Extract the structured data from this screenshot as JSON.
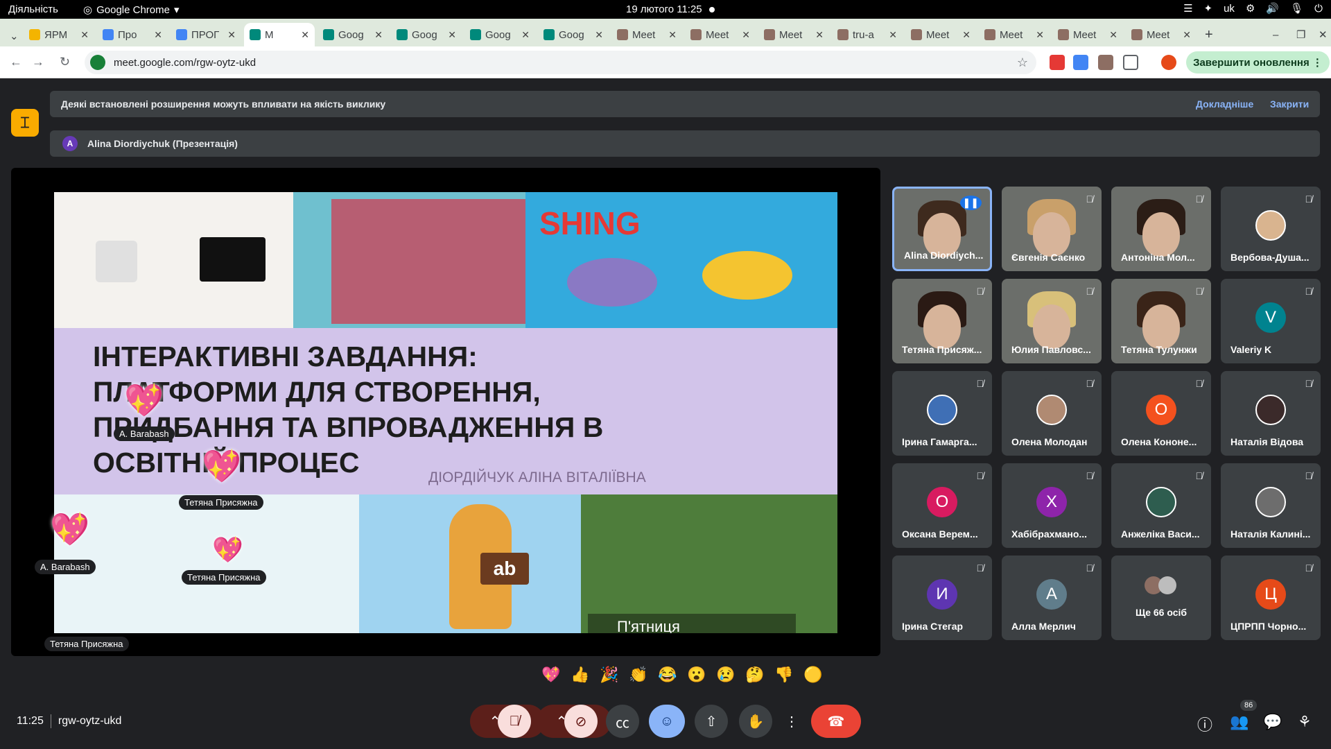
{
  "os": {
    "activities": "Діяльність",
    "app": "Google Chrome",
    "datetime": "19 лютого  11:25",
    "lang": "uk"
  },
  "tabs": [
    {
      "label": "ЯРМ",
      "color": "#f4b400"
    },
    {
      "label": "Про",
      "color": "#4285f4"
    },
    {
      "label": "ПРОГ",
      "color": "#4285f4"
    },
    {
      "label": "М",
      "color": "#00897b",
      "active": true
    },
    {
      "label": "Goog",
      "color": "#00897b"
    },
    {
      "label": "Goog",
      "color": "#00897b"
    },
    {
      "label": "Goog",
      "color": "#00897b"
    },
    {
      "label": "Goog",
      "color": "#00897b"
    },
    {
      "label": "Meet",
      "color": "#8d6e63"
    },
    {
      "label": "Meet",
      "color": "#8d6e63"
    },
    {
      "label": "Meet",
      "color": "#8d6e63"
    },
    {
      "label": "tru-a",
      "color": "#8d6e63"
    },
    {
      "label": "Meet",
      "color": "#8d6e63"
    },
    {
      "label": "Meet",
      "color": "#8d6e63"
    },
    {
      "label": "Meet",
      "color": "#8d6e63"
    },
    {
      "label": "Meet",
      "color": "#8d6e63"
    }
  ],
  "address": {
    "url": "meet.google.com/rgw-oytz-ukd",
    "update_button": "Завершити оновлення"
  },
  "notice": {
    "text": "Деякі встановлені розширення можуть впливати на якість виклику",
    "more": "Докладніше",
    "close": "Закрити"
  },
  "presenter": {
    "initial": "A",
    "label": "Alina Diordiychuk (Презентація)"
  },
  "slide": {
    "title_lines": [
      "ІНТЕРАКТИВНІ ЗАВДАННЯ:",
      "ПЛАТФОРМИ ДЛЯ СТВОРЕННЯ,",
      "ПРИДБАННЯ ТА ВПРОВАДЖЕННЯ В",
      "ОСВІТНІЙ ПРОЦЕС"
    ],
    "author": "ДІОРДІЙЧУК АЛІНА ВІТАЛІЇВНА",
    "top_word": "SHING",
    "tag": "ab",
    "friday": "П'ятниця"
  },
  "reaction_labels": [
    "A. Barabash",
    "Тетяна Присяжна",
    "A. Barabash",
    "Тетяна Присяжна",
    "Тетяна Присяжна"
  ],
  "participants": [
    {
      "name": "Alina Diordiych...",
      "type": "photo",
      "hair": "#3e2a1e",
      "active": true
    },
    {
      "name": "Євгенія Саєнко",
      "type": "photo",
      "hair": "#c9a06a"
    },
    {
      "name": "Антоніна Мол...",
      "type": "photo",
      "hair": "#2b1d16"
    },
    {
      "name": "Вербова-Душа...",
      "type": "avatar",
      "bg": "#d9b48f"
    },
    {
      "name": "Тетяна Присяж...",
      "type": "photo",
      "hair": "#2a1a14"
    },
    {
      "name": "Юлия Павловс...",
      "type": "photo",
      "hair": "#d8c07a"
    },
    {
      "name": "Тетяна Тулунжи",
      "type": "photo",
      "hair": "#3a2418"
    },
    {
      "name": "Valeriy K",
      "type": "letter",
      "letter": "V",
      "bg": "#00838f"
    },
    {
      "name": "Ірина Гамарга...",
      "type": "avatar",
      "bg": "#3f6fb5"
    },
    {
      "name": "Олена Молодан",
      "type": "avatar",
      "bg": "#b08a72"
    },
    {
      "name": "Олена Кононе...",
      "type": "letter",
      "letter": "О",
      "bg": "#f4511e"
    },
    {
      "name": "Наталія Відова",
      "type": "avatar",
      "bg": "#3b2a2a"
    },
    {
      "name": "Оксана Верем...",
      "type": "letter",
      "letter": "О",
      "bg": "#d81b60"
    },
    {
      "name": "Хабібрахмано...",
      "type": "letter",
      "letter": "Х",
      "bg": "#8e24aa"
    },
    {
      "name": "Анжеліка Васи...",
      "type": "avatar",
      "bg": "#2e5d4f"
    },
    {
      "name": "Наталія Калині...",
      "type": "avatar",
      "bg": "#6d6d6d"
    },
    {
      "name": "Ірина Стегар",
      "type": "letter",
      "letter": "И",
      "bg": "#5e35b1"
    },
    {
      "name": "Алла Мерлич",
      "type": "letter",
      "letter": "А",
      "bg": "#607d8b"
    },
    {
      "name": "Ще 66 осіб",
      "type": "more"
    },
    {
      "name": "ЦПРПП Чорно...",
      "type": "letter",
      "letter": "Ц",
      "bg": "#e64a19"
    }
  ],
  "reactions": [
    "💖",
    "👍",
    "🎉",
    "👏",
    "😂",
    "😮",
    "😢",
    "🤔",
    "👎",
    "🟡"
  ],
  "bottom": {
    "time": "11:25",
    "meeting_code": "rgw-oytz-ukd",
    "people_count": "86"
  },
  "colors": {
    "leave": "#ea4335",
    "active_control": "#8ab4f8",
    "muted": "#f9dedc"
  }
}
